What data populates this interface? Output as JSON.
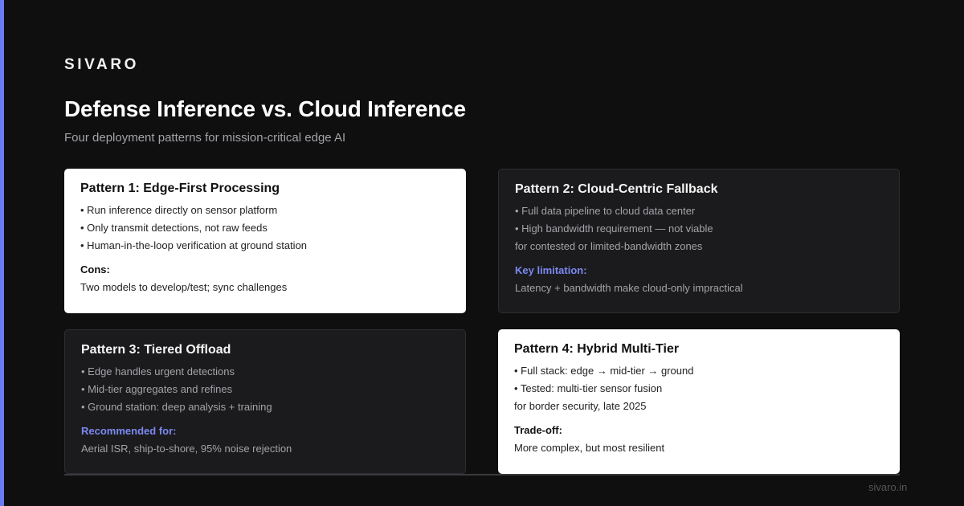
{
  "brand": "SIVARO",
  "title": "Defense Inference vs. Cloud Inference",
  "subtitle": "Four deployment patterns for mission-critical edge AI",
  "colors": {
    "accent": "#6b7cf0",
    "highlight_label": "#7c88f2",
    "background": "#0f0f10",
    "card_light": "#ffffff",
    "card_dark": "#1b1b1d"
  },
  "cards": [
    {
      "title": "Pattern 1: Edge-First Processing",
      "lines": [
        "• Run inference directly on sensor platform",
        "• Only transmit detections, not raw feeds",
        "• Human-in-the-loop verification at ground station"
      ],
      "label": "Cons:",
      "note": "Two models to develop/test; sync challenges"
    },
    {
      "title": "Pattern 2: Cloud-Centric Fallback",
      "lines": [
        "• Full data pipeline to cloud data center",
        "• High bandwidth requirement — not viable",
        "for contested or limited-bandwidth zones"
      ],
      "label": "Key limitation:",
      "note": "Latency + bandwidth make cloud-only impractical"
    },
    {
      "title": "Pattern 3: Tiered Offload",
      "lines": [
        "• Edge handles urgent detections",
        "• Mid-tier aggregates and refines",
        "• Ground station: deep analysis + training"
      ],
      "label": "Recommended for:",
      "note": "Aerial ISR, ship-to-shore, 95% noise rejection"
    },
    {
      "title": "Pattern 4: Hybrid Multi-Tier",
      "lines": [
        "• Full stack: edge → mid-tier → ground",
        "• Tested: multi-tier sensor fusion",
        "for border security, late 2025"
      ],
      "label": "Trade-off:",
      "note": "More complex, but most resilient"
    }
  ],
  "footer": {
    "url": "sivaro.in"
  }
}
